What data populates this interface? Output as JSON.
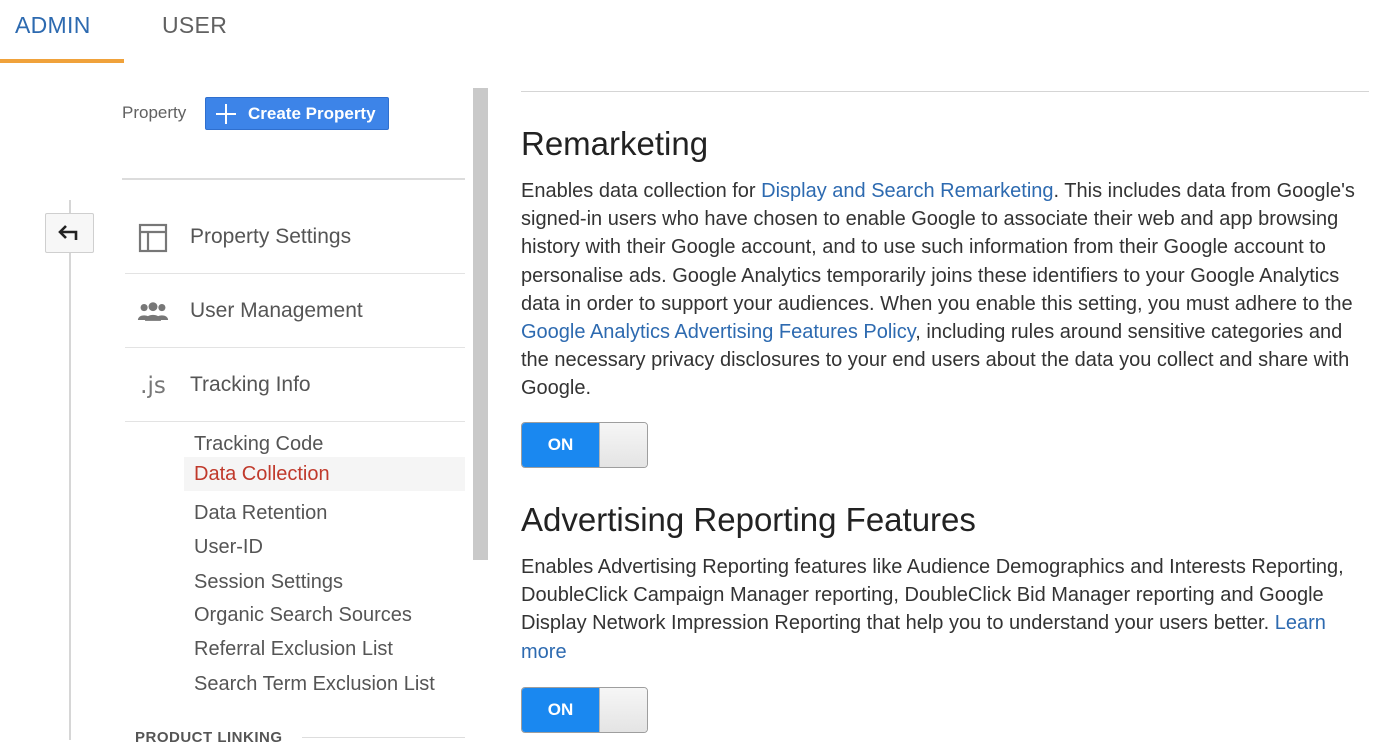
{
  "tabs": {
    "admin": "ADMIN",
    "user": "USER"
  },
  "property": {
    "label": "Property",
    "create_button": "Create Property"
  },
  "nav": {
    "property_settings": "Property Settings",
    "user_management": "User Management",
    "tracking_info": "Tracking Info",
    "tracking_icon": ".js",
    "sub_items": [
      "Tracking Code",
      "Data Collection",
      "Data Retention",
      "User-ID",
      "Session Settings",
      "Organic Search Sources",
      "Referral Exclusion List",
      "Search Term Exclusion List"
    ],
    "active_sub_item": "Data Collection",
    "product_linking": "PRODUCT LINKING"
  },
  "remarketing": {
    "title": "Remarketing",
    "desc_pre": "Enables data collection for ",
    "link1": "Display and Search Remarketing",
    "desc_mid": ". This includes data from Google's signed-in users who have chosen to enable Google to associate their web and app browsing history with their Google account, and to use such information from their Google account to personalise ads. Google Analytics temporarily joins these identifiers to your Google Analytics data in order to support your audiences. When you enable this setting, you must adhere to the ",
    "link2": "Google Analytics Advertising Features Policy",
    "desc_post": ", including rules around sensitive categories and the necessary privacy disclosures to your end users about the data you collect and share with Google.",
    "toggle": "ON"
  },
  "advertising": {
    "title": "Advertising Reporting Features",
    "desc": "Enables Advertising Reporting features like Audience Demographics and Interests Reporting, DoubleClick Campaign Manager reporting, DoubleClick Bid Manager reporting and Google Display Network Impression Reporting that help you to understand your users better. ",
    "link": "Learn more",
    "toggle": "ON"
  },
  "colors": {
    "accent": "#2d6ab0",
    "tab_underline": "#f0a23b",
    "button": "#3d84e8",
    "toggle_on": "#1a88f0",
    "active_item": "#c0392b"
  },
  "icons": [
    "back-arrow-icon",
    "plus-icon",
    "layout-icon",
    "people-icon",
    "js-icon"
  ]
}
